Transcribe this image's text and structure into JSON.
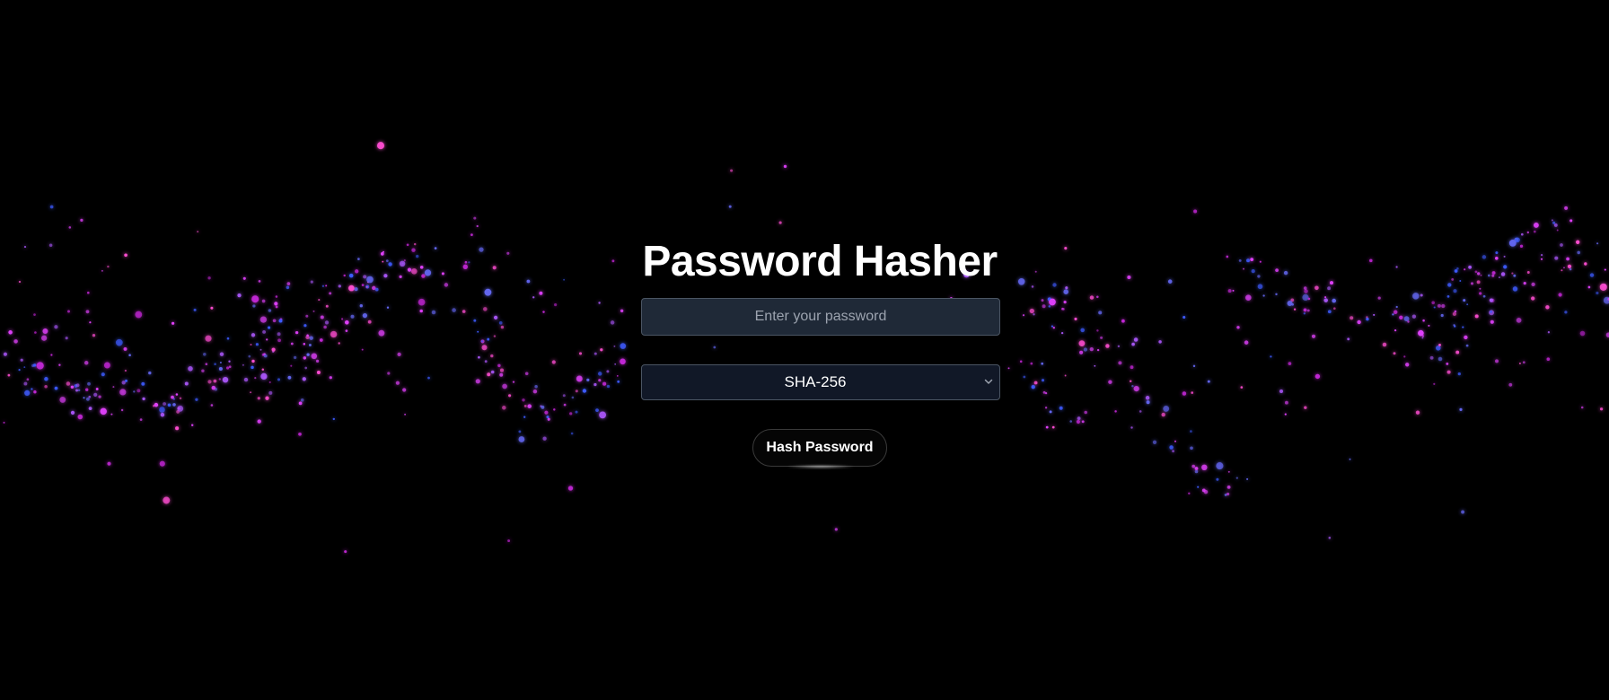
{
  "title": "Password Hasher",
  "password_field": {
    "value": "",
    "placeholder": "Enter your password"
  },
  "algorithm_select": {
    "selected": "SHA-256"
  },
  "hash_button": {
    "label": "Hash Password"
  },
  "colors": {
    "background": "#000000",
    "particle_magenta": "#e040fb",
    "particle_blue": "#3d5afe",
    "input_bg": "#1f2937",
    "select_bg": "#111827",
    "border": "#4b5563"
  },
  "icons": {
    "select_arrow": "chevron-down-icon"
  }
}
